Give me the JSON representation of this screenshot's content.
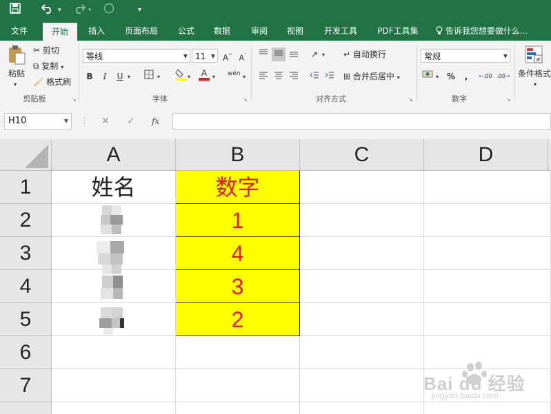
{
  "qat": {
    "save_icon": "save-icon",
    "undo_icon": "undo-icon",
    "redo_icon": "redo-icon"
  },
  "tabs": [
    {
      "label": "文件"
    },
    {
      "label": "开始"
    },
    {
      "label": "插入"
    },
    {
      "label": "页面布局"
    },
    {
      "label": "公式"
    },
    {
      "label": "数据"
    },
    {
      "label": "审阅"
    },
    {
      "label": "视图"
    },
    {
      "label": "开发工具"
    },
    {
      "label": "PDF工具集"
    }
  ],
  "tell_me": "告诉我您想要做什么...",
  "ribbon": {
    "clipboard": {
      "paste": "粘贴",
      "cut": "剪切",
      "copy": "复制",
      "format_painter": "格式刷",
      "group": "剪贴板"
    },
    "font": {
      "name": "等线",
      "size": "11",
      "bold": "B",
      "italic": "I",
      "underline": "U",
      "grow": "A",
      "shrink": "A",
      "color_a": "A",
      "phonetic": "wén",
      "group": "字体"
    },
    "alignment": {
      "wrap": "自动换行",
      "merge": "合并后居中",
      "group": "对齐方式"
    },
    "number": {
      "format": "常规",
      "percent": "%",
      "comma": ",",
      "inc_dec": ".00",
      "group": "数字"
    },
    "styles": {
      "conditional": "条件格式"
    }
  },
  "formula_bar": {
    "name_box": "H10",
    "fx": "fx",
    "cancel": "✕",
    "enter": "✓",
    "value": ""
  },
  "sheet": {
    "columns": [
      "A",
      "B",
      "C",
      "D"
    ],
    "rows": [
      "1",
      "2",
      "3",
      "4",
      "5",
      "6",
      "7"
    ],
    "cells": {
      "A1": "姓名",
      "B1": "数字",
      "B2": "1",
      "B3": "4",
      "B4": "3",
      "B5": "2"
    }
  },
  "watermark": {
    "brand": "Bai du 经验",
    "url": "jingyan.baidu.com"
  },
  "colors": {
    "excel_green": "#217346",
    "yellow_fill": "#ffff00",
    "red_font": "#e01b1b"
  }
}
